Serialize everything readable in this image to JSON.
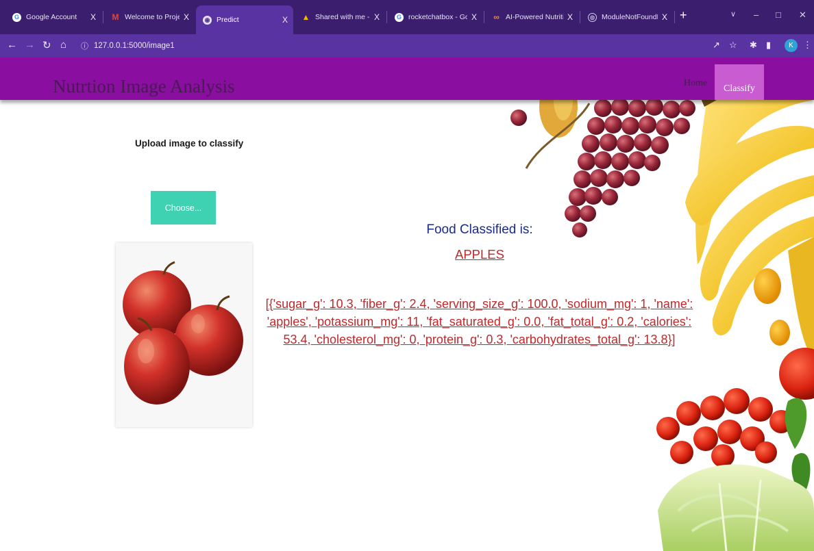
{
  "browser": {
    "tabs": [
      {
        "title": "Google Account",
        "favicon": "google-icon",
        "close": "X"
      },
      {
        "title": "Welcome to Project! I",
        "favicon": "gmail-icon",
        "close": "X"
      },
      {
        "title": "Predict",
        "favicon": "globe-icon",
        "close": "X",
        "active": true
      },
      {
        "title": "Shared with me - Goo",
        "favicon": "drive-icon",
        "close": "X"
      },
      {
        "title": "rocketchatbox - Goog",
        "favicon": "google-icon",
        "close": "X"
      },
      {
        "title": "AI-Powered Nutrition",
        "favicon": "infinity-icon",
        "close": "X"
      },
      {
        "title": "ModuleNotFoundErro",
        "favicon": "module-icon",
        "close": "X"
      }
    ],
    "new_tab": "+",
    "url": "127.0.0.1:5000/image1",
    "profile_initial": "K"
  },
  "site": {
    "title": "Nutrtion Image Analysis",
    "nav": {
      "home": "Home",
      "classify": "Classify"
    }
  },
  "upload": {
    "label": "Upload image to classify",
    "button": "Choose..."
  },
  "result": {
    "title": "Food Classified is:",
    "food": "APPLES",
    "nutrition": "[{'sugar_g': 10.3, 'fiber_g': 2.4, 'serving_size_g': 100.0, 'sodium_mg': 1, 'name': 'apples', 'potassium_mg': 11, 'fat_saturated_g': 0.0, 'fat_total_g': 0.2, 'calories': 53.4, 'cholesterol_mg': 0, 'protein_g': 0.3, 'carbohydrates_total_g': 13.8}]"
  },
  "colors": {
    "header": "#8a0ea0",
    "nav_active": "#c85cd0",
    "choose_button": "#3ed2b2",
    "result_title": "#1a2a8a",
    "result_link": "#c0282a"
  }
}
